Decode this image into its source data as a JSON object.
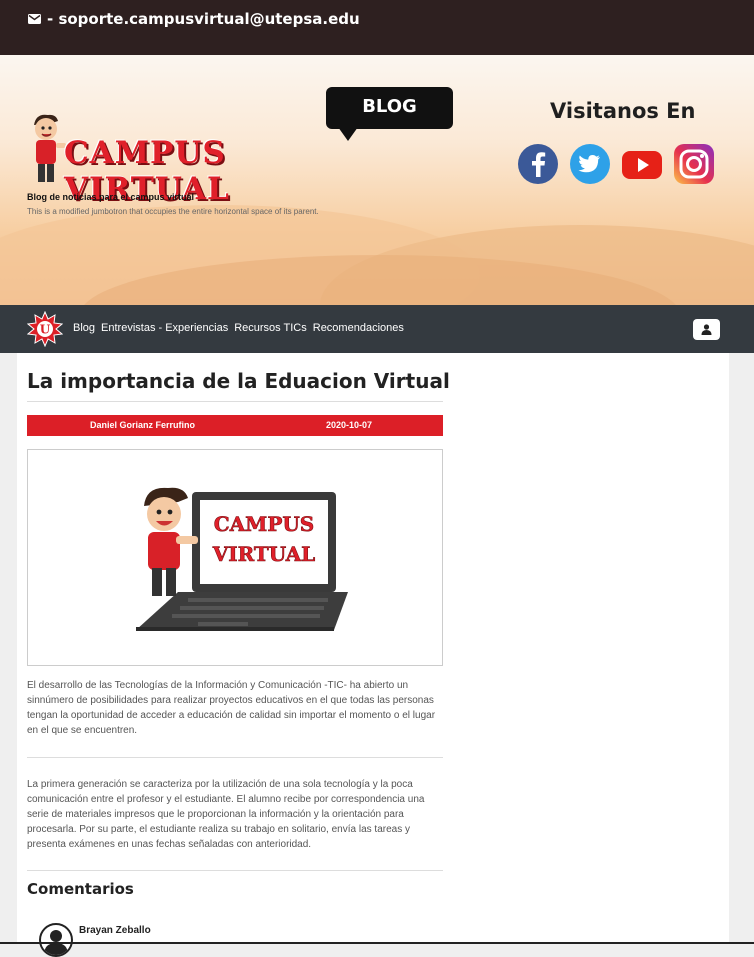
{
  "topbar": {
    "email_text": "- soporte.campusvirtual@utepsa.edu",
    "icon": "envelope-icon"
  },
  "hero": {
    "logo_text": "CAMPUS VIRTUAL",
    "blog_badge": "BLOG",
    "subtitle": "Blog de noticias para el campus virtual",
    "description": "This is a modified jumbotron that occupies the entire horizontal space of its parent.",
    "visit_title": "Visitanos En",
    "social": [
      "facebook-icon",
      "twitter-icon",
      "youtube-icon",
      "instagram-icon"
    ]
  },
  "nav": {
    "logo_letter": "U",
    "links": [
      "Blog",
      "Entrevistas - Experiencias",
      "Recursos TICs",
      "Recomendaciones"
    ],
    "user_icon": "user-icon"
  },
  "post": {
    "title": "La importancia de la Eduacion Virtual",
    "author": "Daniel Gorianz Ferrufino",
    "date": "2020-10-07",
    "image_text_line1": "CAMPUS",
    "image_text_line2": "VIRTUAL",
    "paragraph1": "El desarrollo de las Tecnologías de la Información y Comunicación -TIC- ha abierto un sinnúmero de posibilidades para realizar proyectos educativos en el que todas las personas tengan la oportunidad de acceder a educación de calidad sin importar el momento o el lugar en el que se encuentren.",
    "paragraph2": "La primera generación se caracteriza por la utilización de una sola tecnología y la poca comunicación entre el profesor y el estudiante. El alumno recibe por correspondencia una serie de materiales impresos que le proporcionan la información y la orientación para procesarla. Por su parte, el estudiante realiza su trabajo en solitario, envía las tareas y presenta exámenes en unas fechas señaladas con anterioridad."
  },
  "comments": {
    "title": "Comentarios",
    "items": [
      {
        "author": "Brayan Zeballo"
      }
    ]
  },
  "colors": {
    "accent": "#dc1f27",
    "nav_bg": "#343a40",
    "topbar_bg": "#2e2020"
  }
}
